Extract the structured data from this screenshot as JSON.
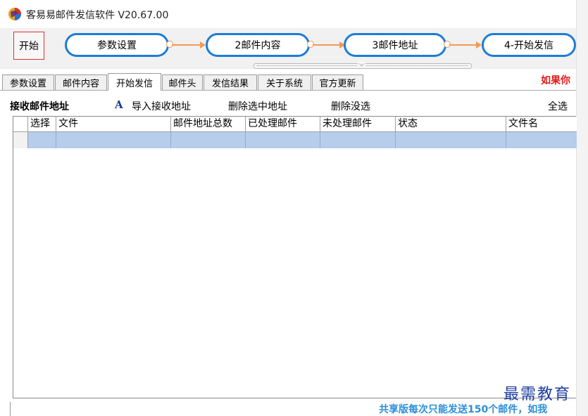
{
  "window": {
    "title": "客易易邮件发信软件 V20.67.00",
    "logo": "app-logo-icon"
  },
  "flow": {
    "start_label": "开始",
    "steps": [
      "参数设置",
      "2邮件内容",
      "3邮件地址",
      "4-开始发信"
    ]
  },
  "tabs": {
    "items": [
      "参数设置",
      "邮件内容",
      "开始发信",
      "邮件头",
      "发信结果",
      "关于系统",
      "官方更新"
    ],
    "active": "开始发信",
    "red_note": "如果你"
  },
  "toolbar": {
    "section_label": "接收邮件地址",
    "import_icon": "A",
    "import_label": "导入接收地址",
    "delete_selected_label": "删除选中地址",
    "delete_unsent_label": "删除没选",
    "select_all_label": "全选"
  },
  "grid": {
    "columns": [
      "选择",
      "文件",
      "邮件地址总数",
      "已处理邮件",
      "未处理邮件",
      "状态",
      "文件名"
    ],
    "rows": [
      [
        "",
        "",
        "",
        "",
        "",
        "",
        ""
      ]
    ]
  },
  "status": {
    "notice": "共享版每次只能发送150个邮件，如我"
  },
  "watermark": "最需教育",
  "colors": {
    "accent": "#1d7cd6",
    "connector": "#f29a55",
    "warning": "#e31b1b",
    "notice": "#2a8fd9",
    "selected_row": "#b6cdec"
  }
}
